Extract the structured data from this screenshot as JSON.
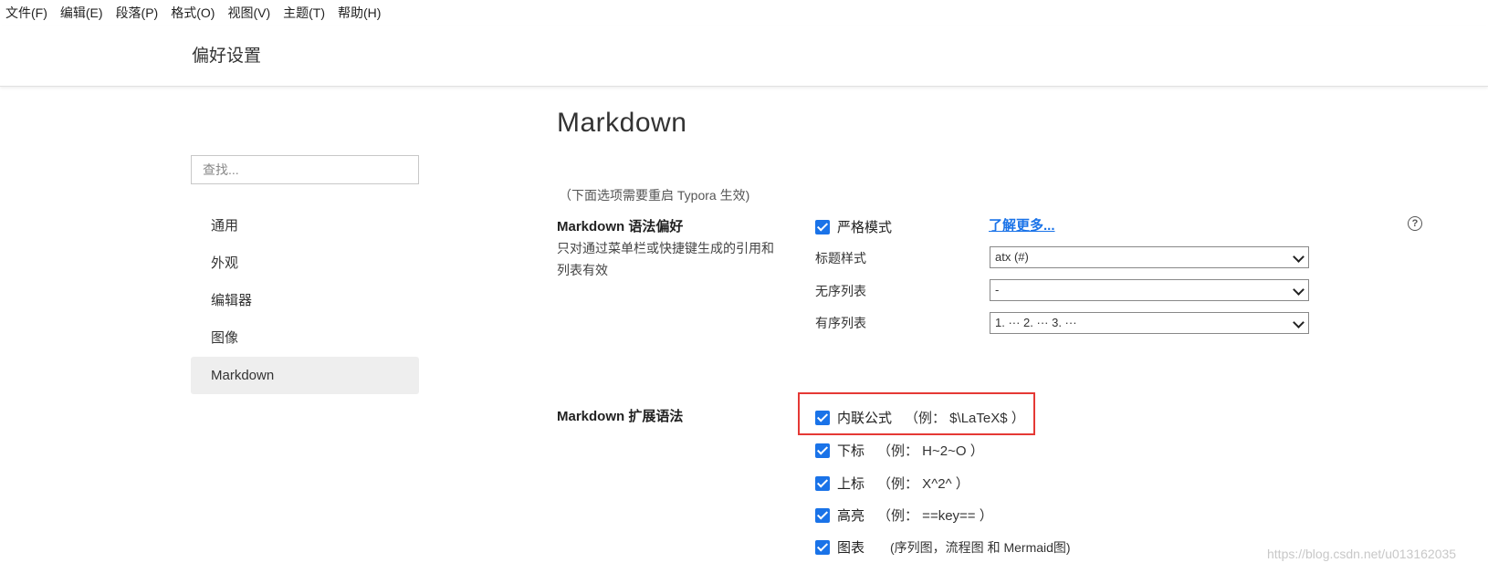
{
  "menu": [
    "文件(F)",
    "编辑(E)",
    "段落(P)",
    "格式(O)",
    "视图(V)",
    "主题(T)",
    "帮助(H)"
  ],
  "header": {
    "title": "偏好设置"
  },
  "search": {
    "placeholder": "查找..."
  },
  "sidebar": {
    "items": [
      {
        "label": "通用",
        "active": false
      },
      {
        "label": "外观",
        "active": false
      },
      {
        "label": "编辑器",
        "active": false
      },
      {
        "label": "图像",
        "active": false
      },
      {
        "label": "Markdown",
        "active": true
      }
    ]
  },
  "main": {
    "title": "Markdown",
    "restart_note": "（下面选项需要重启 Typora 生效)",
    "syntax_pref": {
      "title": "Markdown 语法偏好",
      "desc": "只对通过菜单栏或快捷键生成的引用和列表有效",
      "strict_mode": {
        "label": "严格模式",
        "checked": true
      },
      "learn_more": "了解更多...",
      "help_icon": "question-circle-icon",
      "heading_style": {
        "label": "标题样式",
        "value": "atx (#)"
      },
      "unordered_list": {
        "label": "无序列表",
        "value": "-"
      },
      "ordered_list": {
        "label": "有序列表",
        "value": "1. ··· 2. ··· 3. ···"
      }
    },
    "extended": {
      "title": "Markdown 扩展语法",
      "options": [
        {
          "label": "内联公式",
          "example": "（例： $\\LaTeX$ ）",
          "checked": true
        },
        {
          "label": "下标",
          "example": "（例： H~2~O ）",
          "checked": true
        },
        {
          "label": "上标",
          "example": "（例： X^2^ ）",
          "checked": true
        },
        {
          "label": "高亮",
          "example": "（例： ==key== ）",
          "checked": true
        },
        {
          "label": "图表",
          "example": "(序列图，流程图 和 Mermaid图)",
          "checked": true
        }
      ]
    }
  },
  "watermark": "https://blog.csdn.net/u013162035",
  "colors": {
    "accent": "#1a73e8",
    "highlight": "#e53935",
    "active_nav": "#eeeeee"
  }
}
